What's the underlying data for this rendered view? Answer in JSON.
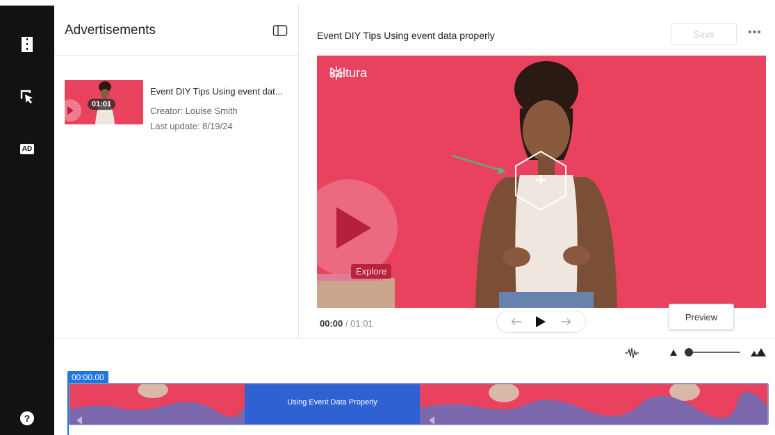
{
  "sidebar": {
    "items": [
      {
        "icon": "film-strip-icon",
        "label": ""
      },
      {
        "icon": "cursor-select-icon",
        "label": ""
      },
      {
        "icon": "ad-icon",
        "label": "AD"
      }
    ],
    "help_icon": "help-icon",
    "help_glyph": "?"
  },
  "list": {
    "title": "Advertisements",
    "entries": [
      {
        "title": "Event DIY Tips Using event dat...",
        "duration": "01:01",
        "creator": "Creator: Louise Smith",
        "updated": "Last update: 8/19/24"
      }
    ]
  },
  "editor": {
    "video_title": "Event DIY Tips Using event data properly",
    "save_label": "Save",
    "more_label": "•••",
    "brand_text": "kaltura",
    "overlay_text": "Explore",
    "hotspot_glyph": "+",
    "time_current": "00:00",
    "time_separator": "/",
    "time_total": "01:01",
    "preview_label": "Preview"
  },
  "timeline": {
    "playhead_time": "00:00.00",
    "ad_segment_label": "Using Event Data Properly",
    "zoom_level": 0.0
  },
  "colors": {
    "rail": "#121212",
    "video_bg": "#e8425f",
    "accent_blue": "#1f76e0",
    "arrow_green": "#5fb07c"
  }
}
